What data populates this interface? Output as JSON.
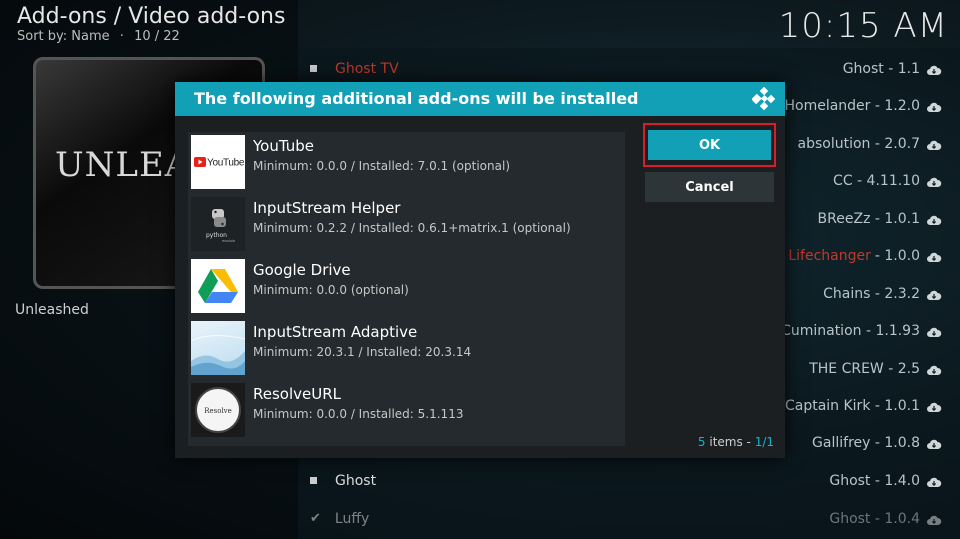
{
  "header": {
    "title": "Add-ons / Video add-ons",
    "sort_label": "Sort by: Name",
    "sep": "·",
    "position": "10 / 22",
    "clock": "10:15 AM"
  },
  "poster": {
    "logo_text": "UNLEASH",
    "label": "Unleashed"
  },
  "list_left": [
    {
      "label": "Ghost TV",
      "style": "red"
    },
    {
      "label": "Ghost",
      "style": "normal"
    },
    {
      "label": "Luffy",
      "style": "check"
    }
  ],
  "list_right": [
    {
      "label": "Ghost - 1.1"
    },
    {
      "label": "Homelander - 1.2.0"
    },
    {
      "label": "absolution - 2.0.7"
    },
    {
      "label": "CC - 4.11.10"
    },
    {
      "label": "BReeZz - 1.0.1"
    },
    {
      "label": "- 1.0.0",
      "prefix": "Lifechanger"
    },
    {
      "label": "Chains - 2.3.2"
    },
    {
      "label": "Cumination - 1.1.93"
    },
    {
      "label": "THE CREW - 2.5"
    },
    {
      "label": "Captain Kirk - 1.0.1"
    },
    {
      "label": "Gallifrey - 1.0.8"
    },
    {
      "label": "Ghost - 1.4.0"
    },
    {
      "label": "Ghost - 1.0.4"
    }
  ],
  "dialog": {
    "title": "The following additional add-ons will be installed",
    "ok_label": "OK",
    "cancel_label": "Cancel",
    "count_items": "5",
    "count_items_suffix": " items - ",
    "count_page": "1/1",
    "items": [
      {
        "name": "YouTube",
        "desc": "Minimum: 0.0.0 / Installed: 7.0.1 (optional)",
        "icon": "youtube-icon"
      },
      {
        "name": "InputStream Helper",
        "desc": "Minimum: 0.2.2 / Installed: 0.6.1+matrix.1 (optional)",
        "icon": "python-icon"
      },
      {
        "name": "Google Drive",
        "desc": "Minimum: 0.0.0 (optional)",
        "icon": "google-drive-icon"
      },
      {
        "name": "InputStream Adaptive",
        "desc": "Minimum: 20.3.1 / Installed: 20.3.14",
        "icon": "wave-icon"
      },
      {
        "name": "ResolveURL",
        "desc": "Minimum: 0.0.0 / Installed: 5.1.113",
        "icon": "resolveurl-icon"
      }
    ]
  },
  "colors": {
    "accent": "#12a0b6",
    "highlight_border": "#d61f2b"
  }
}
